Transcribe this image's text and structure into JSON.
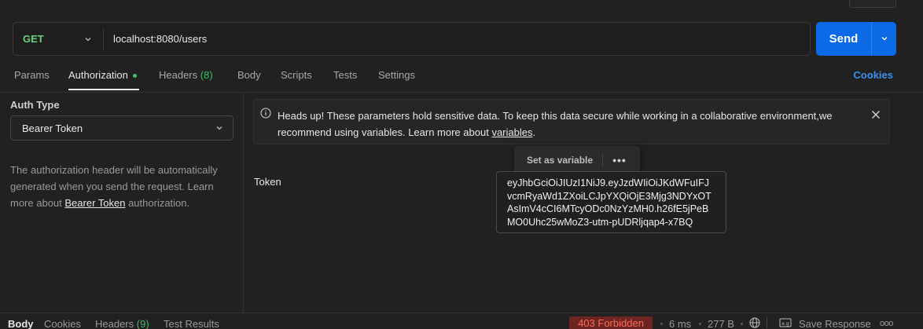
{
  "request": {
    "method": "GET",
    "url": "localhost:8080/users",
    "send_label": "Send"
  },
  "tabs": [
    {
      "label": "Params"
    },
    {
      "label": "Authorization"
    },
    {
      "label": "Headers",
      "count": "(8)"
    },
    {
      "label": "Body"
    },
    {
      "label": "Scripts"
    },
    {
      "label": "Tests"
    },
    {
      "label": "Settings"
    }
  ],
  "cookies_label": "Cookies",
  "auth": {
    "type_label": "Auth Type",
    "type_value": "Bearer Token",
    "desc_prefix": "The authorization header will be automatically generated when you send the request. Learn more about ",
    "desc_link": "Bearer Token",
    "desc_suffix": " authorization."
  },
  "alert": {
    "text": "Heads up! These parameters hold sensitive data. To keep this data secure while working in a collaborative environment,we recommend using variables. Learn more about ",
    "link": "variables",
    "suffix": "."
  },
  "tooltip": {
    "label": "Set as variable",
    "more": "•••"
  },
  "token": {
    "label": "Token",
    "value": "eyJhbGciOiJIUzI1NiJ9.eyJzdWIiOiJKdWFuIFJ\nvcmRyaWd1ZXoiLCJpYXQiOjE3Mjg3NDYxOT\nAsImV4cCI6MTcyODc0NzYzMH0.h26fE5jPeB\nMO0Uhc25wMoZ3-utm-pUDRljqap4-x7BQ"
  },
  "response": {
    "tabs": [
      {
        "label": "Body"
      },
      {
        "label": "Cookies"
      },
      {
        "label": "Headers",
        "count": "(9)"
      },
      {
        "label": "Test Results"
      }
    ],
    "status": "403 Forbidden",
    "time": "6 ms",
    "size": "277 B",
    "save_label": "Save Response",
    "more": "ooo"
  },
  "colors": {
    "accent": "#0d6ae6",
    "method_get": "#6bcf7e",
    "status_error": "#ff6b5b",
    "link": "#3b8fee"
  }
}
